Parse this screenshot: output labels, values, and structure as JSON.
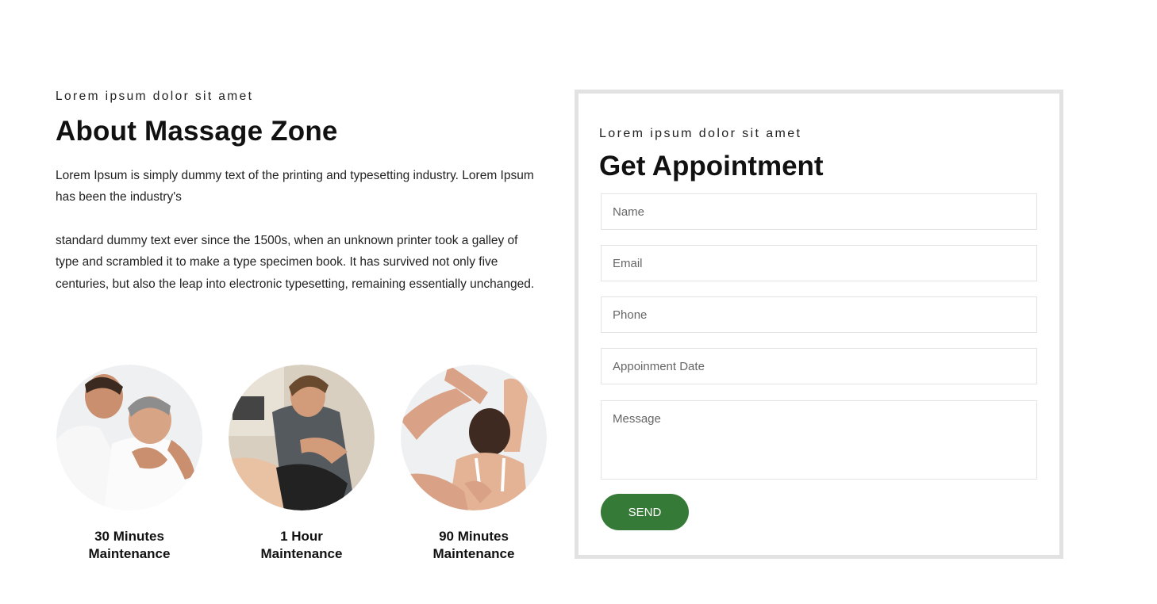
{
  "about": {
    "eyebrow": "Lorem ipsum dolor sit amet",
    "title": "About Massage Zone",
    "paragraph1": "Lorem Ipsum is simply dummy text of the printing and typesetting industry. Lorem Ipsum has been the industry's",
    "paragraph2": "standard dummy text ever since the 1500s, when an unknown printer took a galley of type and scrambled it to make a type specimen book. It has survived not only five centuries, but also the leap into electronic typesetting, remaining essentially unchanged."
  },
  "services": [
    {
      "label_line1": "30 Minutes",
      "label_line2": "Maintenance"
    },
    {
      "label_line1": "1 Hour",
      "label_line2": "Maintenance"
    },
    {
      "label_line1": "90 Minutes",
      "label_line2": "Maintenance"
    }
  ],
  "appointment": {
    "eyebrow": "Lorem ipsum dolor sit amet",
    "title": "Get Appointment",
    "fields": {
      "name_placeholder": "Name",
      "email_placeholder": "Email",
      "phone_placeholder": "Phone",
      "date_placeholder": "Appoinment Date",
      "message_placeholder": "Message"
    },
    "send_label": "SEND"
  },
  "colors": {
    "accent": "#367a37",
    "card_border": "#e2e2e2"
  }
}
